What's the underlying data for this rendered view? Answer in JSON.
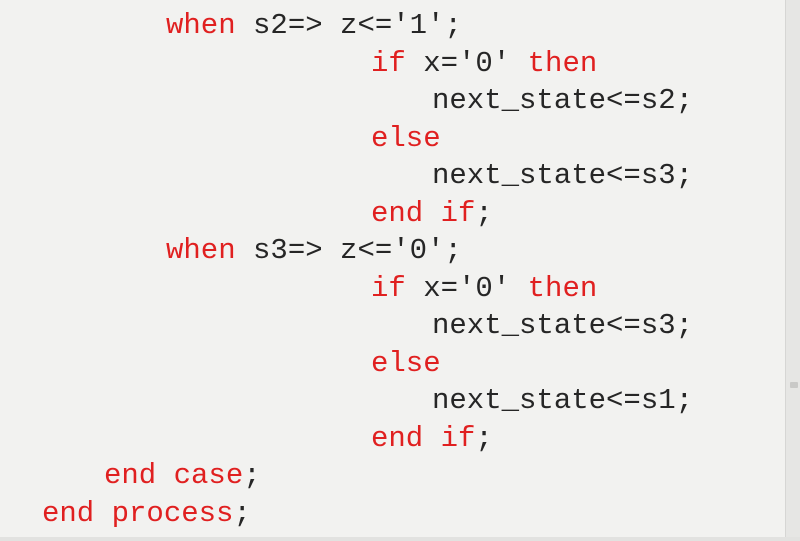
{
  "code": {
    "lines": [
      {
        "indent": "when",
        "parts": [
          {
            "t": "when",
            "k": true
          },
          {
            "t": " s2=> z<='1';",
            "k": false
          }
        ]
      },
      {
        "indent": "stmt",
        "parts": [
          {
            "t": "if",
            "k": true
          },
          {
            "t": " x='0' ",
            "k": false
          },
          {
            "t": "then",
            "k": true
          }
        ]
      },
      {
        "indent": "inner",
        "parts": [
          {
            "t": "next_state<=s2;",
            "k": false
          }
        ]
      },
      {
        "indent": "stmt",
        "parts": [
          {
            "t": "else",
            "k": true
          }
        ]
      },
      {
        "indent": "inner",
        "parts": [
          {
            "t": "next_state<=s3;",
            "k": false
          }
        ]
      },
      {
        "indent": "stmt",
        "parts": [
          {
            "t": "end if",
            "k": true
          },
          {
            "t": ";",
            "k": false
          }
        ]
      },
      {
        "indent": "when",
        "parts": [
          {
            "t": "when",
            "k": true
          },
          {
            "t": " s3=> z<='0';",
            "k": false
          }
        ]
      },
      {
        "indent": "stmt",
        "parts": [
          {
            "t": "if",
            "k": true
          },
          {
            "t": " x='0' ",
            "k": false
          },
          {
            "t": "then",
            "k": true
          }
        ]
      },
      {
        "indent": "inner",
        "parts": [
          {
            "t": "next_state<=s3;",
            "k": false
          }
        ]
      },
      {
        "indent": "stmt",
        "parts": [
          {
            "t": "else",
            "k": true
          }
        ]
      },
      {
        "indent": "inner",
        "parts": [
          {
            "t": "next_state<=s1;",
            "k": false
          }
        ]
      },
      {
        "indent": "stmt",
        "parts": [
          {
            "t": "end if",
            "k": true
          },
          {
            "t": ";",
            "k": false
          }
        ]
      },
      {
        "indent": "case",
        "parts": [
          {
            "t": "end case",
            "k": true
          },
          {
            "t": ";",
            "k": false
          }
        ]
      },
      {
        "indent": "proc",
        "parts": [
          {
            "t": "end process",
            "k": true
          },
          {
            "t": ";",
            "k": false
          }
        ]
      }
    ]
  },
  "colors": {
    "keyword": "#e02020",
    "text": "#262626",
    "background": "#f2f2f0"
  }
}
